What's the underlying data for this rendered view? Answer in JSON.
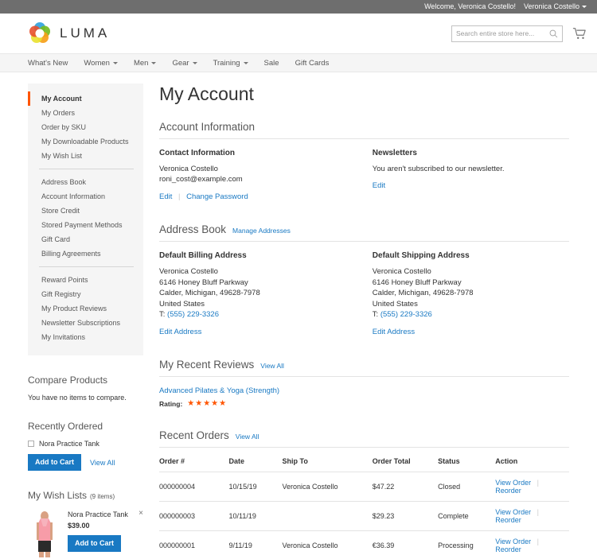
{
  "topbar": {
    "welcome": "Welcome, Veronica Costello!",
    "account_menu": "Veronica Costello"
  },
  "header": {
    "logo_text": "LUMA",
    "search_placeholder": "Search entire store here...",
    "search_value": ""
  },
  "nav": {
    "items": [
      {
        "label": "What's New",
        "has_caret": false
      },
      {
        "label": "Women",
        "has_caret": true
      },
      {
        "label": "Men",
        "has_caret": true
      },
      {
        "label": "Gear",
        "has_caret": true
      },
      {
        "label": "Training",
        "has_caret": true
      },
      {
        "label": "Sale",
        "has_caret": false
      },
      {
        "label": "Gift Cards",
        "has_caret": false
      }
    ]
  },
  "sidebar": {
    "group1": [
      "My Account",
      "My Orders",
      "Order by SKU",
      "My Downloadable Products",
      "My Wish List"
    ],
    "group2": [
      "Address Book",
      "Account Information",
      "Store Credit",
      "Stored Payment Methods",
      "Gift Card",
      "Billing Agreements"
    ],
    "group3": [
      "Reward Points",
      "Gift Registry",
      "My Product Reviews",
      "Newsletter Subscriptions",
      "My Invitations"
    ],
    "compare": {
      "title": "Compare Products",
      "empty_text": "You have no items to compare."
    },
    "recently_ordered": {
      "title": "Recently Ordered",
      "item_label": "Nora Practice Tank",
      "add_to_cart": "Add to Cart",
      "view_all": "View All"
    },
    "wish_lists": {
      "title": "My Wish Lists",
      "count": "(9 items)",
      "item_name": "Nora Practice Tank",
      "item_price": "$39.00",
      "add_to_cart": "Add to Cart",
      "remove": "×"
    }
  },
  "main": {
    "page_title": "My Account",
    "account_information": {
      "section_title": "Account Information",
      "contact": {
        "title": "Contact Information",
        "name": "Veronica Costello",
        "email": "roni_cost@example.com",
        "edit": "Edit",
        "change_password": "Change Password"
      },
      "newsletters": {
        "title": "Newsletters",
        "status": "You aren't subscribed to our newsletter.",
        "edit": "Edit"
      }
    },
    "address_book": {
      "section_title": "Address Book",
      "manage_link": "Manage Addresses",
      "billing": {
        "title": "Default Billing Address",
        "name": "Veronica Costello",
        "street": "6146 Honey Bluff Parkway",
        "city_state_zip": "Calder, Michigan, 49628-7978",
        "country": "United States",
        "phone_prefix": "T:",
        "phone": "(555) 229-3326",
        "edit": "Edit Address"
      },
      "shipping": {
        "title": "Default Shipping Address",
        "name": "Veronica Costello",
        "street": "6146 Honey Bluff Parkway",
        "city_state_zip": "Calder, Michigan, 49628-7978",
        "country": "United States",
        "phone_prefix": "T:",
        "phone": "(555) 229-3326",
        "edit": "Edit Address"
      }
    },
    "recent_reviews": {
      "section_title": "My Recent Reviews",
      "view_all": "View All",
      "product_name": "Advanced Pilates & Yoga (Strength)",
      "rating_label": "Rating:",
      "rating_stars": "★★★★★"
    },
    "recent_orders": {
      "section_title": "Recent Orders",
      "view_all": "View All",
      "columns": [
        "Order #",
        "Date",
        "Ship To",
        "Order Total",
        "Status",
        "Action"
      ],
      "rows": [
        {
          "order": "000000004",
          "date": "10/15/19",
          "ship_to": "Veronica Costello",
          "total": "$47.22",
          "status": "Closed",
          "view": "View Order",
          "reorder": "Reorder"
        },
        {
          "order": "000000003",
          "date": "10/11/19",
          "ship_to": "",
          "total": "$29.23",
          "status": "Complete",
          "view": "View Order",
          "reorder": "Reorder"
        },
        {
          "order": "000000001",
          "date": "9/11/19",
          "ship_to": "Veronica Costello",
          "total": "€36.39",
          "status": "Processing",
          "view": "View Order",
          "reorder": "Reorder"
        }
      ]
    }
  },
  "colors": {
    "accent_orange": "#ff5501",
    "link_blue": "#1979c3",
    "topbar_gray": "#6e6e6e",
    "nav_bg": "#f5f5f5"
  }
}
